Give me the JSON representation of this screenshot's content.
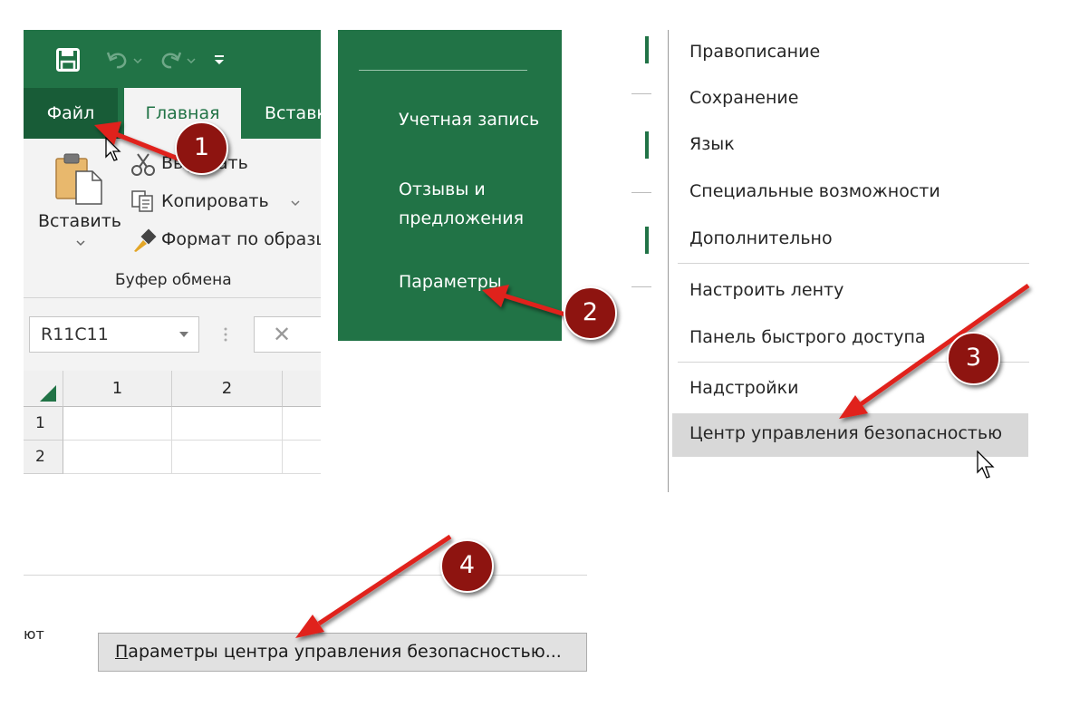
{
  "ribbon": {
    "tab_file": "Файл",
    "tab_home": "Главная",
    "tab_insert": "Вставка",
    "cut_label": "Вырезать",
    "copy_label": "Копировать",
    "format_painter_label": "Формат по образцу",
    "paste_label": "Вставить",
    "group_label": "Буфер обмена",
    "name_box": "R11C11",
    "cancel_symbol": "✕",
    "columns": [
      "1",
      "2"
    ],
    "rows": [
      "1",
      "2"
    ]
  },
  "backstage": {
    "items": [
      "Учетная запись",
      "Отзывы и предложения",
      "Параметры"
    ]
  },
  "options_nav": {
    "items": [
      "Правописание",
      "Сохранение",
      "Язык",
      "Специальные возможности",
      "Дополнительно",
      "Настроить ленту",
      "Панель быстрого доступа",
      "Надстройки",
      "Центр управления безопасностью"
    ],
    "selected": "Центр управления безопасностью"
  },
  "trust_center": {
    "fragment_text": "ют",
    "settings_button": "Параметры центра управления безопасностью...",
    "settings_button_first_letter": "П",
    "settings_button_rest": "араметры центра управления безопасностью..."
  },
  "annotations": {
    "steps": [
      "1",
      "2",
      "3",
      "4"
    ],
    "badge_color": "#8e1410",
    "arrow_color": "#e0201c"
  },
  "theme": {
    "excel_green": "#217346",
    "excel_green_dark": "#185c37"
  }
}
